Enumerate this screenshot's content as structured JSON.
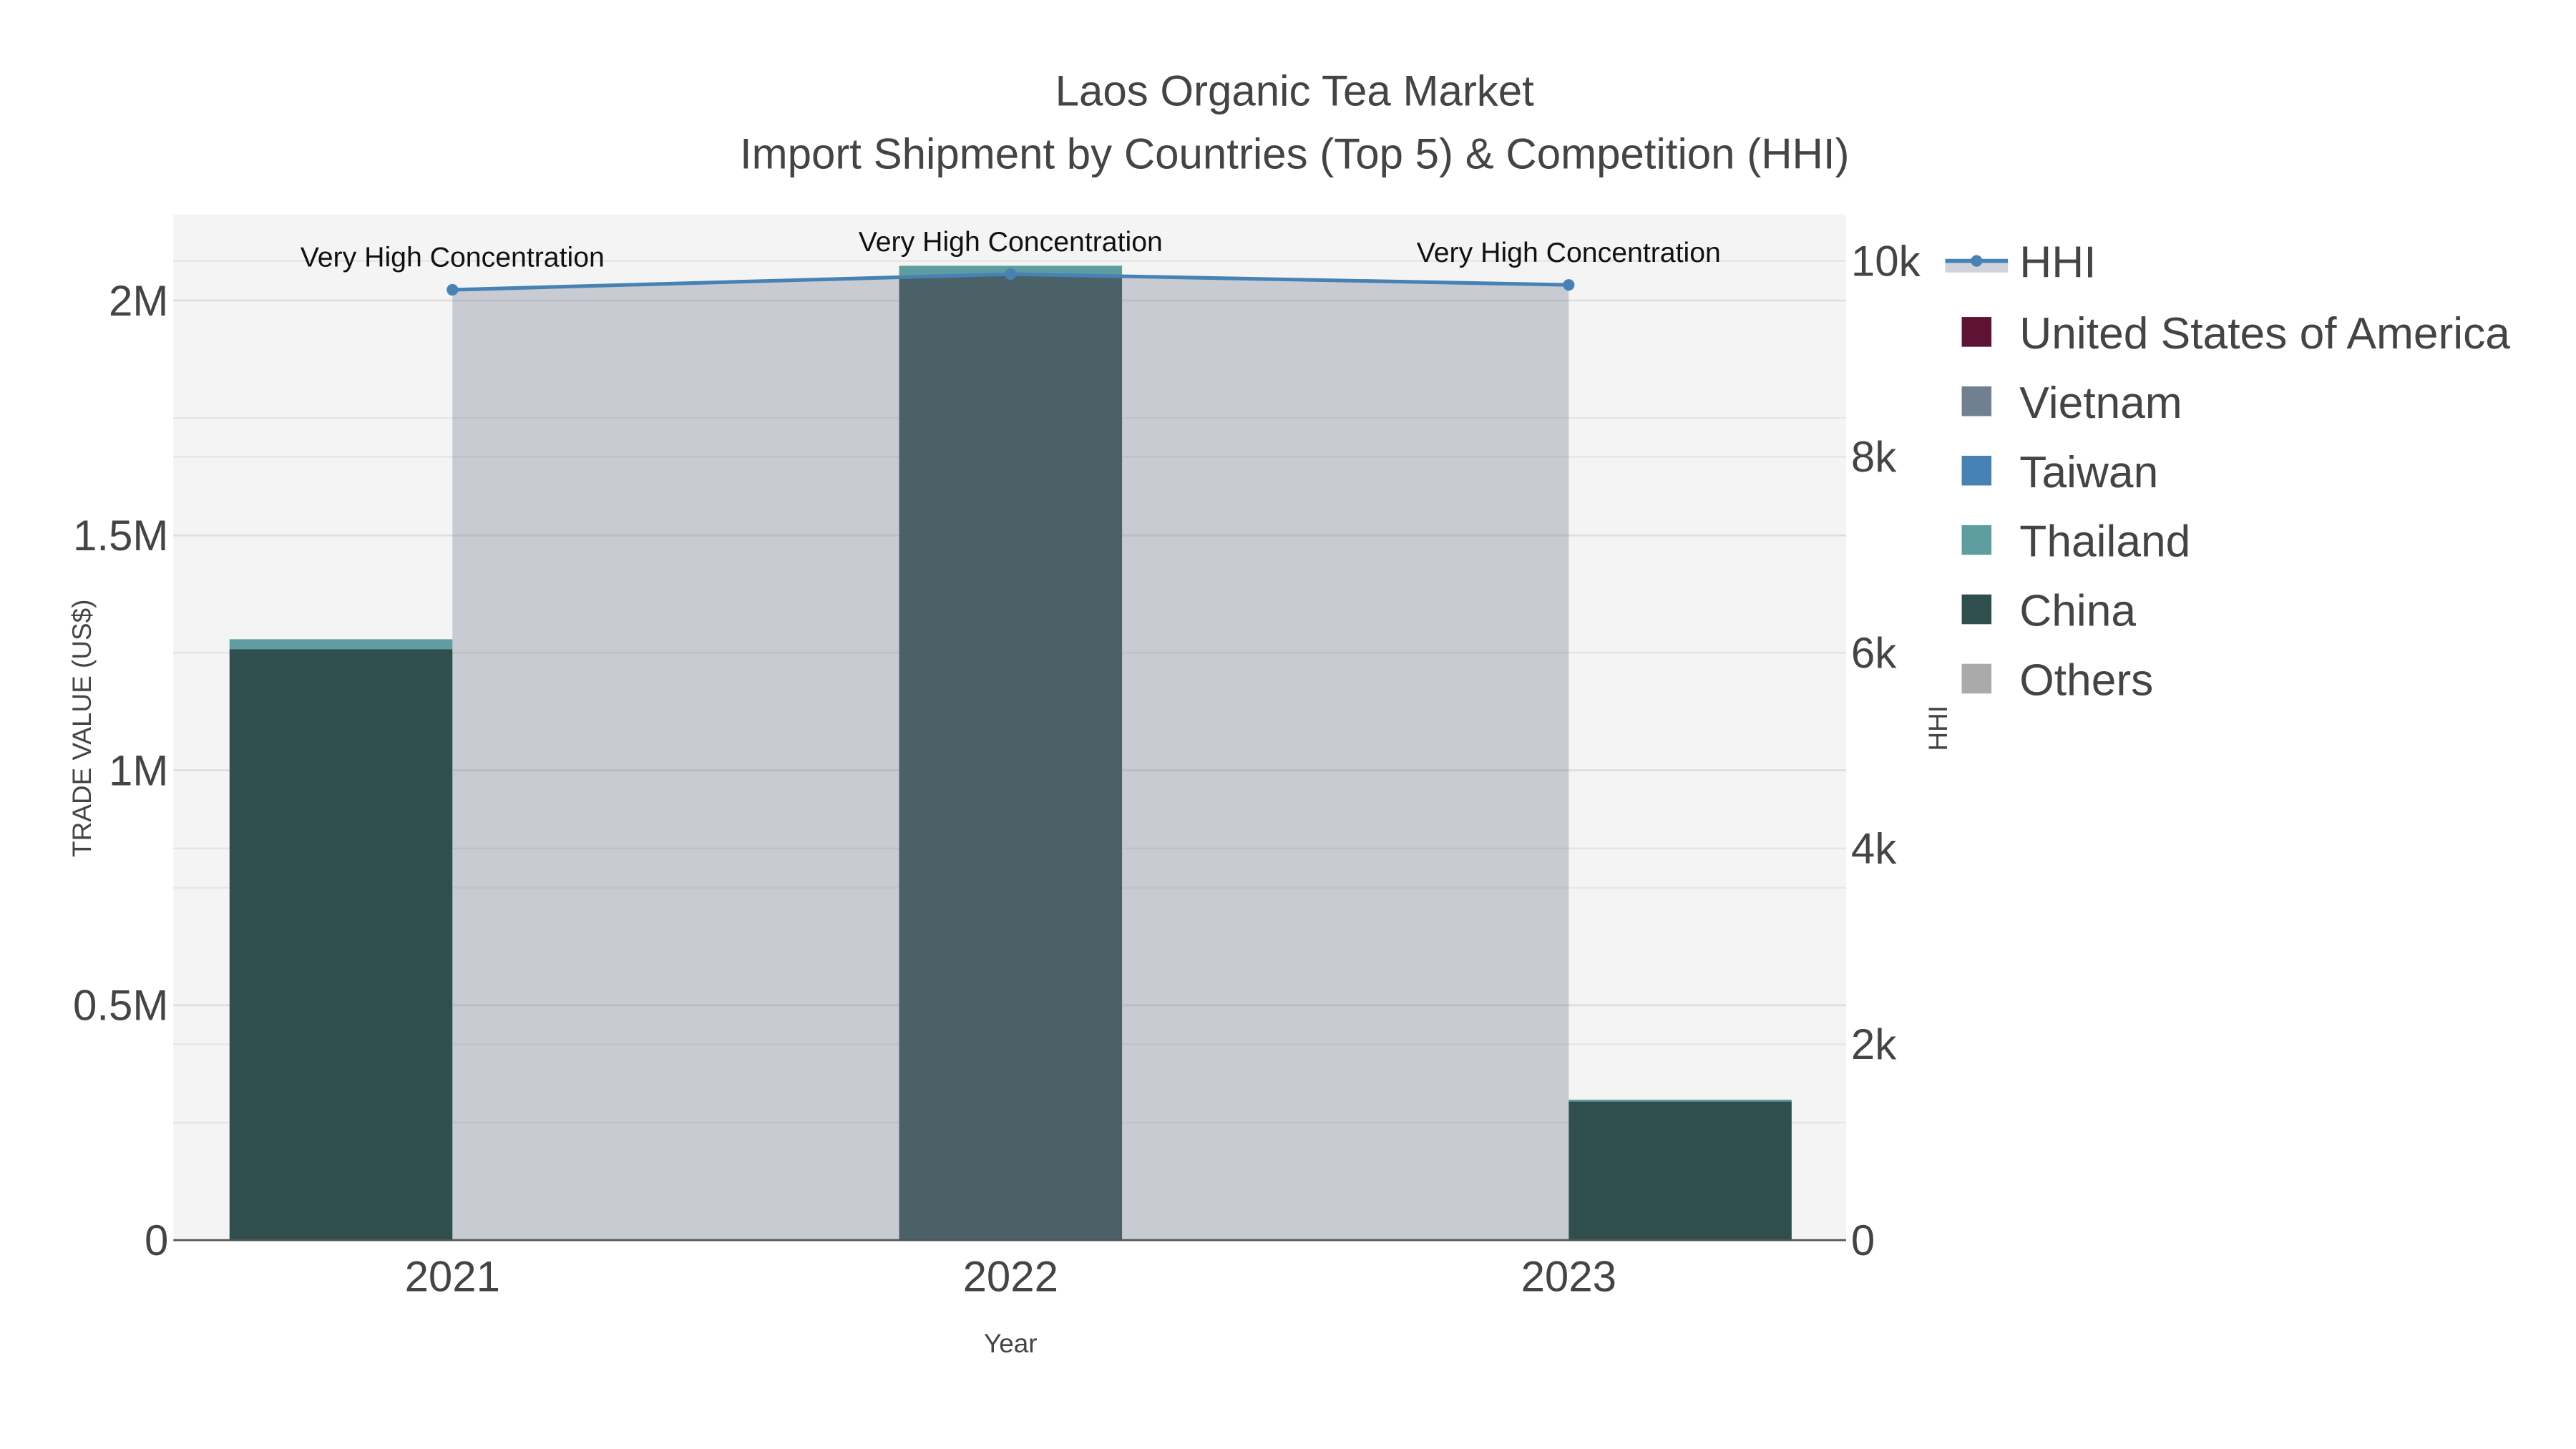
{
  "chart_data": {
    "type": "bar",
    "barmode": "stack",
    "title": "Laos Organic Tea Market",
    "subtitle": "Import Shipment by Countries (Top 5) & Competition (HHI)",
    "xlabel": "Year",
    "ylabel": "TRADE VALUE (US$)",
    "y2label": "HHI",
    "categories": [
      "2021",
      "2022",
      "2023"
    ],
    "ylim": [
      0,
      2180000
    ],
    "y2lim": [
      0,
      10400
    ],
    "yticks": [
      {
        "v": 0,
        "label": "0"
      },
      {
        "v": 500000,
        "label": "0.5M"
      },
      {
        "v": 1000000,
        "label": "1M"
      },
      {
        "v": 1500000,
        "label": "1.5M"
      },
      {
        "v": 2000000,
        "label": "2M"
      }
    ],
    "y2ticks": [
      {
        "v": 0,
        "label": "0"
      },
      {
        "v": 2000,
        "label": "2k"
      },
      {
        "v": 4000,
        "label": "4k"
      },
      {
        "v": 6000,
        "label": "6k"
      },
      {
        "v": 8000,
        "label": "8k"
      },
      {
        "v": 10000,
        "label": "10k"
      }
    ],
    "grid": true,
    "legend_position": "right",
    "series": [
      {
        "name": "United States of America",
        "color": "#5e1234",
        "values": [
          0,
          0,
          0
        ]
      },
      {
        "name": "Vietnam",
        "color": "#708090",
        "values": [
          0,
          0,
          0
        ]
      },
      {
        "name": "Taiwan",
        "color": "#4682b4",
        "values": [
          0,
          0,
          0
        ]
      },
      {
        "name": "China",
        "color": "#2f4f4f",
        "values": [
          1258000,
          2053000,
          295000
        ]
      },
      {
        "name": "Thailand",
        "color": "#5f9ea0",
        "values": [
          21000,
          21000,
          4000
        ]
      },
      {
        "name": "Others",
        "color": "#aaaaaa",
        "values": [
          0,
          0,
          0
        ]
      }
    ],
    "legend_order": [
      "United States of America",
      "Vietnam",
      "Taiwan",
      "Thailand",
      "China",
      "Others"
    ],
    "hhi": {
      "name": "HHI",
      "color": "#4682b4",
      "values": [
        9705,
        9865,
        9755
      ],
      "annotations": [
        "Very High Concentration",
        "Very High Concentration",
        "Very High Concentration"
      ]
    }
  }
}
